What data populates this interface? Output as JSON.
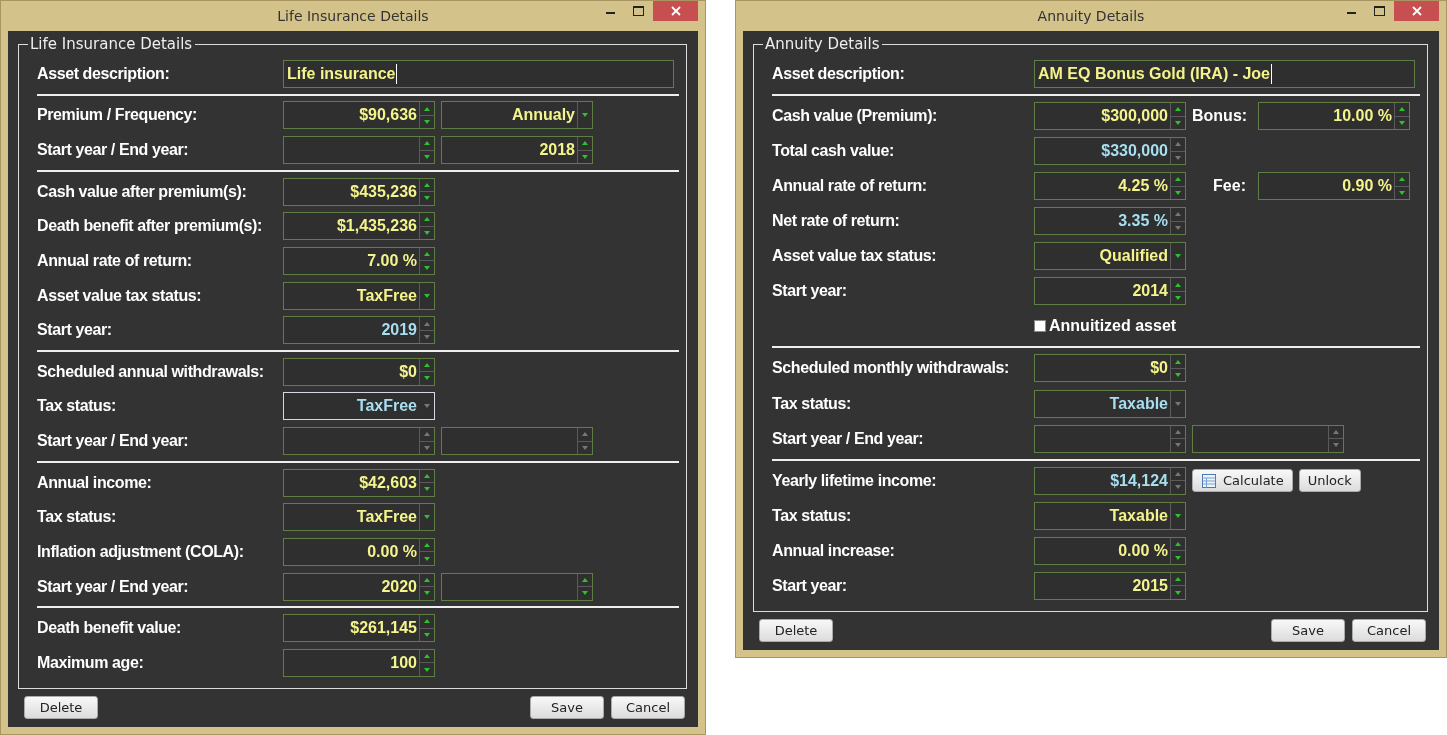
{
  "windows": [
    {
      "title": "Life Insurance Details",
      "group_title": "Life Insurance Details",
      "sections": [
        [
          {
            "label": "Asset description:",
            "items": [
              {
                "kind": "text",
                "value": "Life insurance",
                "focused": true
              }
            ]
          }
        ],
        [
          {
            "label": "Premium / Frequency:",
            "items": [
              {
                "kind": "spin",
                "value": "$90,636"
              },
              {
                "kind": "combo",
                "value": "Annualy"
              }
            ]
          },
          {
            "label": "Start year / End year:",
            "items": [
              {
                "kind": "spin"
              },
              {
                "kind": "spin",
                "value": "2018"
              }
            ]
          }
        ],
        [
          {
            "label": "Cash value after premium(s):",
            "items": [
              {
                "kind": "spin",
                "value": "$435,236"
              }
            ]
          },
          {
            "label": "Death benefit after premium(s):",
            "items": [
              {
                "kind": "spin",
                "value": "$1,435,236"
              }
            ]
          },
          {
            "label": "Annual rate of return:",
            "items": [
              {
                "kind": "spin",
                "value": "7.00 %"
              }
            ]
          },
          {
            "label": "Asset value tax status:",
            "items": [
              {
                "kind": "combo",
                "value": "TaxFree"
              }
            ]
          },
          {
            "label": "Start year:",
            "items": [
              {
                "kind": "spin",
                "value": "2019",
                "disabled": true
              }
            ]
          }
        ],
        [
          {
            "label": "Scheduled annual withdrawals:",
            "items": [
              {
                "kind": "spin",
                "value": "$0"
              }
            ]
          },
          {
            "label": "Tax status:",
            "items": [
              {
                "kind": "combo",
                "value": "TaxFree",
                "disabled": true,
                "focused": true
              }
            ]
          },
          {
            "label": "Start year / End year:",
            "items": [
              {
                "kind": "spin",
                "disabled": true
              },
              {
                "kind": "spin",
                "disabled": true
              }
            ]
          }
        ],
        [
          {
            "label": "Annual income:",
            "items": [
              {
                "kind": "spin",
                "value": "$42,603"
              }
            ]
          },
          {
            "label": "Tax status:",
            "items": [
              {
                "kind": "combo",
                "value": "TaxFree"
              }
            ]
          },
          {
            "label": "Inflation adjustment (COLA):",
            "items": [
              {
                "kind": "spin",
                "value": "0.00 %"
              }
            ]
          },
          {
            "label": "Start year / End year:",
            "items": [
              {
                "kind": "spin",
                "value": "2020"
              },
              {
                "kind": "spin"
              }
            ]
          }
        ],
        [
          {
            "label": "Death benefit value:",
            "items": [
              {
                "kind": "spin",
                "value": "$261,145"
              }
            ]
          },
          {
            "label": "Maximum age:",
            "items": [
              {
                "kind": "spin",
                "value": "100"
              }
            ]
          }
        ]
      ],
      "buttons": {
        "left": [
          "Delete"
        ],
        "right": [
          "Save",
          "Cancel"
        ]
      }
    },
    {
      "title": "Annuity Details",
      "group_title": "Annuity Details",
      "sections": [
        [
          {
            "label": "Asset description:",
            "items": [
              {
                "kind": "text",
                "value": "AM EQ Bonus Gold (IRA) - Joe",
                "focused": true
              }
            ]
          }
        ],
        [
          {
            "label": "Cash value (Premium):",
            "items": [
              {
                "kind": "spin",
                "value": "$300,000"
              },
              {
                "kind": "label",
                "text": "Bonus:"
              },
              {
                "kind": "spin",
                "value": "10.00 %"
              }
            ]
          },
          {
            "label": "Total cash value:",
            "items": [
              {
                "kind": "spin",
                "value": "$330,000",
                "disabled": true
              }
            ]
          },
          {
            "label": "Annual rate of return:",
            "items": [
              {
                "kind": "spin",
                "value": "4.25 %"
              },
              {
                "kind": "label",
                "text": "Fee:"
              },
              {
                "kind": "spin",
                "value": "0.90 %"
              }
            ]
          },
          {
            "label": "Net rate of return:",
            "items": [
              {
                "kind": "spin",
                "value": "3.35 %",
                "disabled": true
              }
            ]
          },
          {
            "label": "Asset value tax status:",
            "items": [
              {
                "kind": "combo",
                "value": "Qualified"
              }
            ]
          },
          {
            "label": "Start year:",
            "items": [
              {
                "kind": "spin",
                "value": "2014"
              }
            ]
          },
          {
            "items": [
              {
                "kind": "checkbox",
                "text": "Annuitized asset",
                "checked": false
              }
            ]
          }
        ],
        [
          {
            "label": "Scheduled monthly withdrawals:",
            "items": [
              {
                "kind": "spin",
                "value": "$0"
              }
            ]
          },
          {
            "label": "Tax status:",
            "items": [
              {
                "kind": "combo",
                "value": "Taxable",
                "disabled": true
              }
            ]
          },
          {
            "label": "Start year / End year:",
            "items": [
              {
                "kind": "spin",
                "disabled": true
              },
              {
                "kind": "spin",
                "disabled": true
              }
            ]
          }
        ],
        [
          {
            "label": "Yearly lifetime income:",
            "items": [
              {
                "kind": "spin",
                "value": "$14,124",
                "disabled": true
              },
              {
                "kind": "button",
                "text": "Calculate",
                "icon": true
              },
              {
                "kind": "button",
                "text": "Unlock"
              }
            ]
          },
          {
            "label": "Tax status:",
            "items": [
              {
                "kind": "combo",
                "value": "Taxable"
              }
            ]
          },
          {
            "label": "Annual increase:",
            "items": [
              {
                "kind": "spin",
                "value": "0.00 %"
              }
            ]
          },
          {
            "label": "Start year:",
            "items": [
              {
                "kind": "spin",
                "value": "2015"
              }
            ]
          }
        ]
      ],
      "buttons": {
        "left": [
          "Delete"
        ],
        "right": [
          "Save",
          "Cancel"
        ]
      }
    }
  ]
}
